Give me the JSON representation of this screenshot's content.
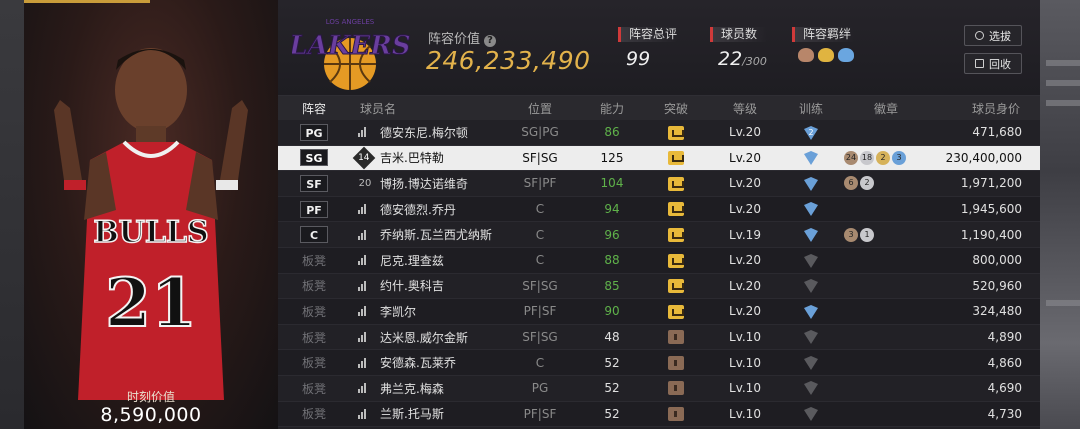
{
  "player": {
    "moment_label": "时刻价值",
    "moment_value": "8,590,000",
    "jersey_team": "BULLS",
    "jersey_number": "21"
  },
  "header": {
    "team_logo_text": "LAKERS",
    "team_logo_subtext": "LOS ANGELES",
    "lineup_value_label": "阵容价值",
    "lineup_value": "246,233,490",
    "rating_label": "阵容总评",
    "rating_value": "99",
    "players_label": "球员数",
    "players_value": "22",
    "players_max": "/300",
    "bond_label": "阵容羁绊",
    "select_button": "选拔",
    "recycle_button": "回收"
  },
  "columns": {
    "lineup": "阵容",
    "name": "球员名",
    "position": "位置",
    "rating": "能力",
    "breakthrough": "突破",
    "level": "等级",
    "training": "训练",
    "badges": "徽章",
    "worth": "球员身价"
  },
  "rows": [
    {
      "slot": "PG",
      "starter": true,
      "icon": "bars",
      "name": "德安东尼.梅尔顿",
      "position": "SG|PG",
      "rating": "86",
      "rating_green": true,
      "crown": "gold",
      "level": "Lv.20",
      "train": "2",
      "badges": [],
      "worth": "471,680"
    },
    {
      "slot": "SG",
      "starter": true,
      "icon": "14",
      "name": "吉米.巴特勒",
      "position": "SF|SG",
      "rating": "125",
      "rating_green": false,
      "crown": "gold",
      "level": "Lv.20",
      "train": "shield",
      "badges": [
        {
          "t": "24",
          "c": "bronze"
        },
        {
          "t": "18",
          "c": "silver"
        },
        {
          "t": "2",
          "c": "gold"
        },
        {
          "t": "3",
          "c": "blue"
        }
      ],
      "worth": "230,400,000"
    },
    {
      "slot": "SF",
      "starter": true,
      "icon": "20",
      "name": "博扬.博达诺维奇",
      "position": "SF|PF",
      "rating": "104",
      "rating_green": true,
      "crown": "gold",
      "level": "Lv.20",
      "train": "shield",
      "badges": [
        {
          "t": "6",
          "c": "bronze"
        },
        {
          "t": "2",
          "c": "silver"
        }
      ],
      "worth": "1,971,200"
    },
    {
      "slot": "PF",
      "starter": true,
      "icon": "bars",
      "name": "德安德烈.乔丹",
      "position": "C",
      "rating": "94",
      "rating_green": true,
      "crown": "gold",
      "level": "Lv.20",
      "train": "shield",
      "badges": [],
      "worth": "1,945,600"
    },
    {
      "slot": "C",
      "starter": true,
      "icon": "bars",
      "name": "乔纳斯.瓦兰西尤纳斯",
      "position": "C",
      "rating": "96",
      "rating_green": true,
      "crown": "gold",
      "level": "Lv.19",
      "train": "shield",
      "badges": [
        {
          "t": "3",
          "c": "bronze"
        },
        {
          "t": "1",
          "c": "silver"
        }
      ],
      "worth": "1,190,400"
    },
    {
      "slot": "板凳",
      "starter": false,
      "icon": "bars",
      "name": "尼克.理查兹",
      "position": "C",
      "rating": "88",
      "rating_green": true,
      "crown": "gold",
      "level": "Lv.20",
      "train": "gray",
      "badges": [],
      "worth": "800,000"
    },
    {
      "slot": "板凳",
      "starter": false,
      "icon": "bars",
      "name": "约什.奥科吉",
      "position": "SF|SG",
      "rating": "85",
      "rating_green": true,
      "crown": "gold",
      "level": "Lv.20",
      "train": "gray",
      "badges": [],
      "worth": "520,960"
    },
    {
      "slot": "板凳",
      "starter": false,
      "icon": "bars",
      "name": "李凯尔",
      "position": "PF|SF",
      "rating": "90",
      "rating_green": true,
      "crown": "gold",
      "level": "Lv.20",
      "train": "shield",
      "badges": [],
      "worth": "324,480"
    },
    {
      "slot": "板凳",
      "starter": false,
      "icon": "bars",
      "name": "达米恩.威尔金斯",
      "position": "SF|SG",
      "rating": "48",
      "rating_green": false,
      "crown": "lock",
      "level": "Lv.10",
      "train": "gray",
      "badges": [],
      "worth": "4,890"
    },
    {
      "slot": "板凳",
      "starter": false,
      "icon": "bars",
      "name": "安德森.瓦莱乔",
      "position": "C",
      "rating": "52",
      "rating_green": false,
      "crown": "lock",
      "level": "Lv.10",
      "train": "gray",
      "badges": [],
      "worth": "4,860"
    },
    {
      "slot": "板凳",
      "starter": false,
      "icon": "bars",
      "name": "弗兰克.梅森",
      "position": "PG",
      "rating": "52",
      "rating_green": false,
      "crown": "lock",
      "level": "Lv.10",
      "train": "gray",
      "badges": [],
      "worth": "4,690"
    },
    {
      "slot": "板凳",
      "starter": false,
      "icon": "bars",
      "name": "兰斯.托马斯",
      "position": "PF|SF",
      "rating": "52",
      "rating_green": false,
      "crown": "lock",
      "level": "Lv.10",
      "train": "gray",
      "badges": [],
      "worth": "4,730"
    }
  ],
  "colors": {
    "gold_text": "#e2b24b",
    "green_text": "#5fb24a",
    "accent_red": "#d03a3a"
  }
}
